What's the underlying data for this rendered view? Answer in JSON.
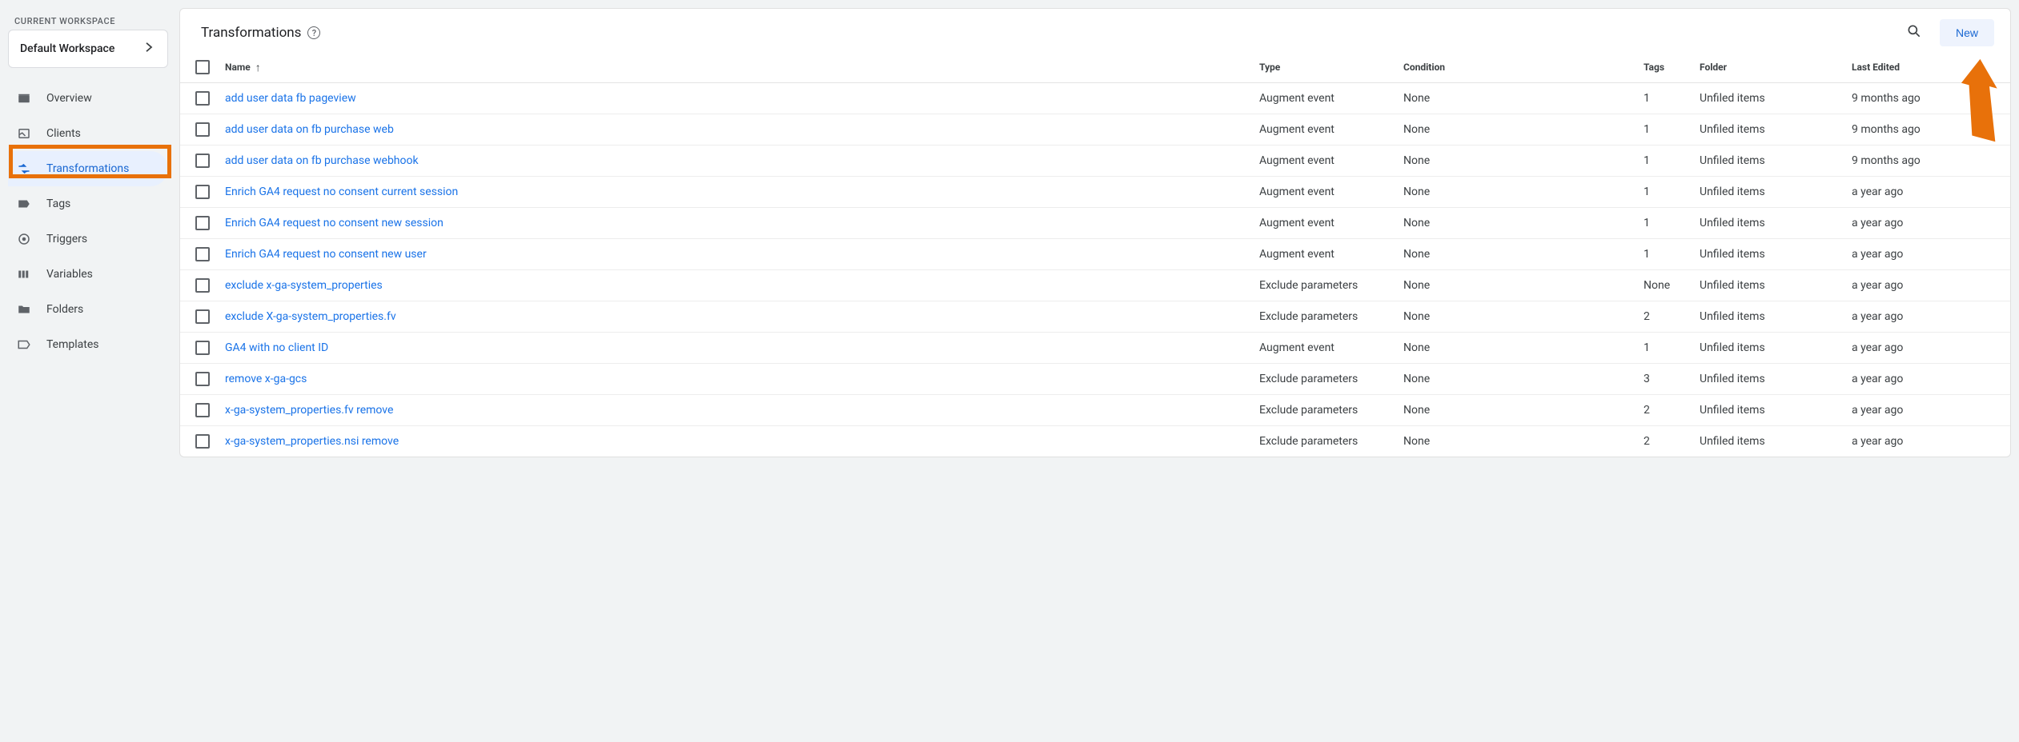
{
  "workspace": {
    "section_label": "CURRENT WORKSPACE",
    "name": "Default Workspace"
  },
  "nav": {
    "items": [
      {
        "key": "overview",
        "label": "Overview",
        "active": false
      },
      {
        "key": "clients",
        "label": "Clients",
        "active": false
      },
      {
        "key": "transformations",
        "label": "Transformations",
        "active": true
      },
      {
        "key": "tags",
        "label": "Tags",
        "active": false
      },
      {
        "key": "triggers",
        "label": "Triggers",
        "active": false
      },
      {
        "key": "variables",
        "label": "Variables",
        "active": false
      },
      {
        "key": "folders",
        "label": "Folders",
        "active": false
      },
      {
        "key": "templates",
        "label": "Templates",
        "active": false
      }
    ]
  },
  "page": {
    "title": "Transformations",
    "new_button": "New"
  },
  "table": {
    "headers": {
      "name": "Name",
      "type": "Type",
      "condition": "Condition",
      "tags": "Tags",
      "folder": "Folder",
      "last_edited": "Last Edited"
    },
    "rows": [
      {
        "name": "add user data fb pageview",
        "type": "Augment event",
        "condition": "None",
        "tags": "1",
        "folder": "Unfiled items",
        "last_edited": "9 months ago"
      },
      {
        "name": "add user data on fb purchase web",
        "type": "Augment event",
        "condition": "None",
        "tags": "1",
        "folder": "Unfiled items",
        "last_edited": "9 months ago"
      },
      {
        "name": "add user data on fb purchase webhook",
        "type": "Augment event",
        "condition": "None",
        "tags": "1",
        "folder": "Unfiled items",
        "last_edited": "9 months ago"
      },
      {
        "name": "Enrich GA4 request no consent current session",
        "type": "Augment event",
        "condition": "None",
        "tags": "1",
        "folder": "Unfiled items",
        "last_edited": "a year ago"
      },
      {
        "name": "Enrich GA4 request no consent new session",
        "type": "Augment event",
        "condition": "None",
        "tags": "1",
        "folder": "Unfiled items",
        "last_edited": "a year ago"
      },
      {
        "name": "Enrich GA4 request no consent new user",
        "type": "Augment event",
        "condition": "None",
        "tags": "1",
        "folder": "Unfiled items",
        "last_edited": "a year ago"
      },
      {
        "name": "exclude x-ga-system_properties",
        "type": "Exclude parameters",
        "condition": "None",
        "tags": "None",
        "folder": "Unfiled items",
        "last_edited": "a year ago"
      },
      {
        "name": "exclude X-ga-system_properties.fv",
        "type": "Exclude parameters",
        "condition": "None",
        "tags": "2",
        "folder": "Unfiled items",
        "last_edited": "a year ago"
      },
      {
        "name": "GA4 with no client ID",
        "type": "Augment event",
        "condition": "None",
        "tags": "1",
        "folder": "Unfiled items",
        "last_edited": "a year ago"
      },
      {
        "name": "remove x-ga-gcs",
        "type": "Exclude parameters",
        "condition": "None",
        "tags": "3",
        "folder": "Unfiled items",
        "last_edited": "a year ago"
      },
      {
        "name": "x-ga-system_properties.fv remove",
        "type": "Exclude parameters",
        "condition": "None",
        "tags": "2",
        "folder": "Unfiled items",
        "last_edited": "a year ago"
      },
      {
        "name": "x-ga-system_properties.nsi remove",
        "type": "Exclude parameters",
        "condition": "None",
        "tags": "2",
        "folder": "Unfiled items",
        "last_edited": "a year ago"
      }
    ]
  }
}
